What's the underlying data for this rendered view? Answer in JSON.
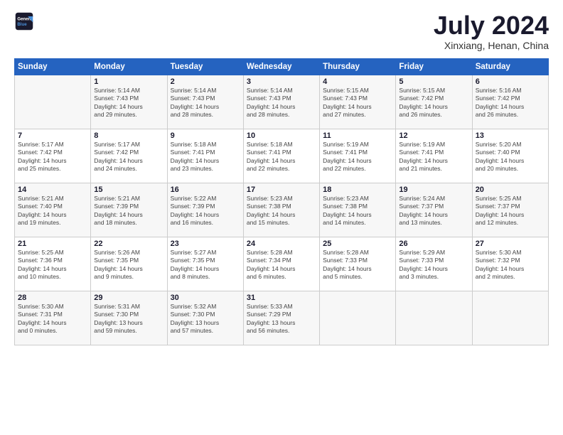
{
  "header": {
    "logo_line1": "General",
    "logo_line2": "Blue",
    "month": "July 2024",
    "location": "Xinxiang, Henan, China"
  },
  "days_header": [
    "Sunday",
    "Monday",
    "Tuesday",
    "Wednesday",
    "Thursday",
    "Friday",
    "Saturday"
  ],
  "weeks": [
    [
      {
        "day": "",
        "info": ""
      },
      {
        "day": "1",
        "info": "Sunrise: 5:14 AM\nSunset: 7:43 PM\nDaylight: 14 hours\nand 29 minutes."
      },
      {
        "day": "2",
        "info": "Sunrise: 5:14 AM\nSunset: 7:43 PM\nDaylight: 14 hours\nand 28 minutes."
      },
      {
        "day": "3",
        "info": "Sunrise: 5:14 AM\nSunset: 7:43 PM\nDaylight: 14 hours\nand 28 minutes."
      },
      {
        "day": "4",
        "info": "Sunrise: 5:15 AM\nSunset: 7:43 PM\nDaylight: 14 hours\nand 27 minutes."
      },
      {
        "day": "5",
        "info": "Sunrise: 5:15 AM\nSunset: 7:42 PM\nDaylight: 14 hours\nand 26 minutes."
      },
      {
        "day": "6",
        "info": "Sunrise: 5:16 AM\nSunset: 7:42 PM\nDaylight: 14 hours\nand 26 minutes."
      }
    ],
    [
      {
        "day": "7",
        "info": "Sunrise: 5:17 AM\nSunset: 7:42 PM\nDaylight: 14 hours\nand 25 minutes."
      },
      {
        "day": "8",
        "info": "Sunrise: 5:17 AM\nSunset: 7:42 PM\nDaylight: 14 hours\nand 24 minutes."
      },
      {
        "day": "9",
        "info": "Sunrise: 5:18 AM\nSunset: 7:41 PM\nDaylight: 14 hours\nand 23 minutes."
      },
      {
        "day": "10",
        "info": "Sunrise: 5:18 AM\nSunset: 7:41 PM\nDaylight: 14 hours\nand 22 minutes."
      },
      {
        "day": "11",
        "info": "Sunrise: 5:19 AM\nSunset: 7:41 PM\nDaylight: 14 hours\nand 22 minutes."
      },
      {
        "day": "12",
        "info": "Sunrise: 5:19 AM\nSunset: 7:41 PM\nDaylight: 14 hours\nand 21 minutes."
      },
      {
        "day": "13",
        "info": "Sunrise: 5:20 AM\nSunset: 7:40 PM\nDaylight: 14 hours\nand 20 minutes."
      }
    ],
    [
      {
        "day": "14",
        "info": "Sunrise: 5:21 AM\nSunset: 7:40 PM\nDaylight: 14 hours\nand 19 minutes."
      },
      {
        "day": "15",
        "info": "Sunrise: 5:21 AM\nSunset: 7:39 PM\nDaylight: 14 hours\nand 18 minutes."
      },
      {
        "day": "16",
        "info": "Sunrise: 5:22 AM\nSunset: 7:39 PM\nDaylight: 14 hours\nand 16 minutes."
      },
      {
        "day": "17",
        "info": "Sunrise: 5:23 AM\nSunset: 7:38 PM\nDaylight: 14 hours\nand 15 minutes."
      },
      {
        "day": "18",
        "info": "Sunrise: 5:23 AM\nSunset: 7:38 PM\nDaylight: 14 hours\nand 14 minutes."
      },
      {
        "day": "19",
        "info": "Sunrise: 5:24 AM\nSunset: 7:37 PM\nDaylight: 14 hours\nand 13 minutes."
      },
      {
        "day": "20",
        "info": "Sunrise: 5:25 AM\nSunset: 7:37 PM\nDaylight: 14 hours\nand 12 minutes."
      }
    ],
    [
      {
        "day": "21",
        "info": "Sunrise: 5:25 AM\nSunset: 7:36 PM\nDaylight: 14 hours\nand 10 minutes."
      },
      {
        "day": "22",
        "info": "Sunrise: 5:26 AM\nSunset: 7:35 PM\nDaylight: 14 hours\nand 9 minutes."
      },
      {
        "day": "23",
        "info": "Sunrise: 5:27 AM\nSunset: 7:35 PM\nDaylight: 14 hours\nand 8 minutes."
      },
      {
        "day": "24",
        "info": "Sunrise: 5:28 AM\nSunset: 7:34 PM\nDaylight: 14 hours\nand 6 minutes."
      },
      {
        "day": "25",
        "info": "Sunrise: 5:28 AM\nSunset: 7:33 PM\nDaylight: 14 hours\nand 5 minutes."
      },
      {
        "day": "26",
        "info": "Sunrise: 5:29 AM\nSunset: 7:33 PM\nDaylight: 14 hours\nand 3 minutes."
      },
      {
        "day": "27",
        "info": "Sunrise: 5:30 AM\nSunset: 7:32 PM\nDaylight: 14 hours\nand 2 minutes."
      }
    ],
    [
      {
        "day": "28",
        "info": "Sunrise: 5:30 AM\nSunset: 7:31 PM\nDaylight: 14 hours\nand 0 minutes."
      },
      {
        "day": "29",
        "info": "Sunrise: 5:31 AM\nSunset: 7:30 PM\nDaylight: 13 hours\nand 59 minutes."
      },
      {
        "day": "30",
        "info": "Sunrise: 5:32 AM\nSunset: 7:30 PM\nDaylight: 13 hours\nand 57 minutes."
      },
      {
        "day": "31",
        "info": "Sunrise: 5:33 AM\nSunset: 7:29 PM\nDaylight: 13 hours\nand 56 minutes."
      },
      {
        "day": "",
        "info": ""
      },
      {
        "day": "",
        "info": ""
      },
      {
        "day": "",
        "info": ""
      }
    ]
  ]
}
